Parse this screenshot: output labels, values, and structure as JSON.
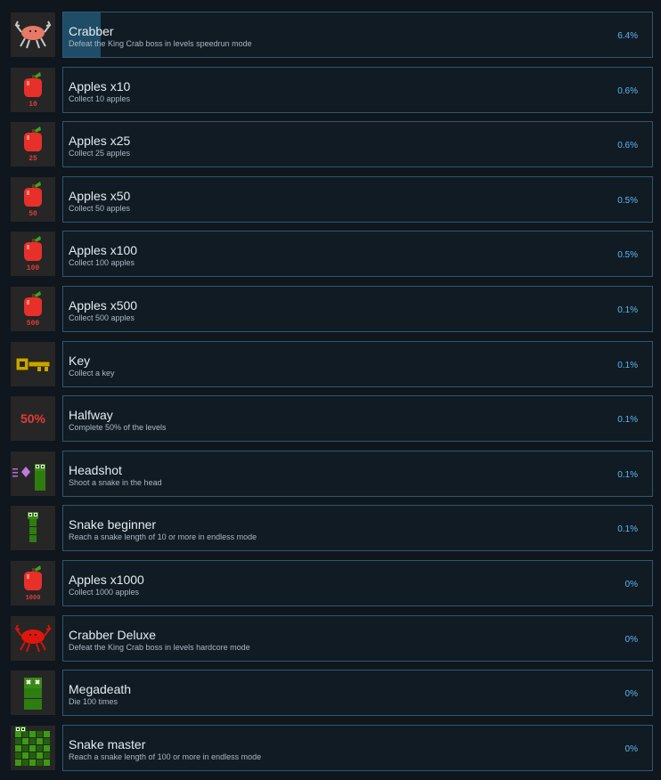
{
  "achievements": [
    {
      "title": "Crabber",
      "desc": "Defeat the King Crab boss in levels speedrun mode",
      "percent": "6.4%",
      "progress": 0.064,
      "icon": "crab-pink-icon"
    },
    {
      "title": "Apples x10",
      "desc": "Collect 10 apples",
      "percent": "0.6%",
      "icon": "apple-10-icon",
      "badge": "10"
    },
    {
      "title": "Apples x25",
      "desc": "Collect 25 apples",
      "percent": "0.6%",
      "icon": "apple-25-icon",
      "badge": "25"
    },
    {
      "title": "Apples x50",
      "desc": "Collect 50 apples",
      "percent": "0.5%",
      "icon": "apple-50-icon",
      "badge": "50"
    },
    {
      "title": "Apples x100",
      "desc": "Collect 100 apples",
      "percent": "0.5%",
      "icon": "apple-100-icon",
      "badge": "100"
    },
    {
      "title": "Apples x500",
      "desc": "Collect 500 apples",
      "percent": "0.1%",
      "icon": "apple-500-icon",
      "badge": "500"
    },
    {
      "title": "Key",
      "desc": "Collect a key",
      "percent": "0.1%",
      "icon": "key-icon"
    },
    {
      "title": "Halfway",
      "desc": "Complete 50% of the levels",
      "percent": "0.1%",
      "icon": "halfway-50-icon",
      "badge": "50%"
    },
    {
      "title": "Headshot",
      "desc": "Shoot a snake in the head",
      "percent": "0.1%",
      "icon": "headshot-snake-icon"
    },
    {
      "title": "Snake beginner",
      "desc": "Reach a snake length of 10 or more in endless mode",
      "percent": "0.1%",
      "icon": "snake-small-icon"
    },
    {
      "title": "Apples x1000",
      "desc": "Collect 1000 apples",
      "percent": "0%",
      "icon": "apple-1000-icon",
      "badge": "1000"
    },
    {
      "title": "Crabber Deluxe",
      "desc": "Defeat the King Crab boss in levels hardcore mode",
      "percent": "0%",
      "icon": "crab-red-icon"
    },
    {
      "title": "Megadeath",
      "desc": "Die 100 times",
      "percent": "0%",
      "icon": "dead-snake-icon"
    },
    {
      "title": "Snake master",
      "desc": "Reach a snake length of 100 or more in endless mode",
      "percent": "0%",
      "icon": "snake-checker-icon"
    }
  ],
  "colors": {
    "background": "#0f161d",
    "panel_border": "#2c5870",
    "progress_fill": "#1f4c66",
    "percent_text": "#5fb7f2",
    "apple_red": "#e8302a",
    "badge_red": "#e23c36",
    "snake_green": "#2e7d10",
    "key_gold": "#c9a400"
  }
}
